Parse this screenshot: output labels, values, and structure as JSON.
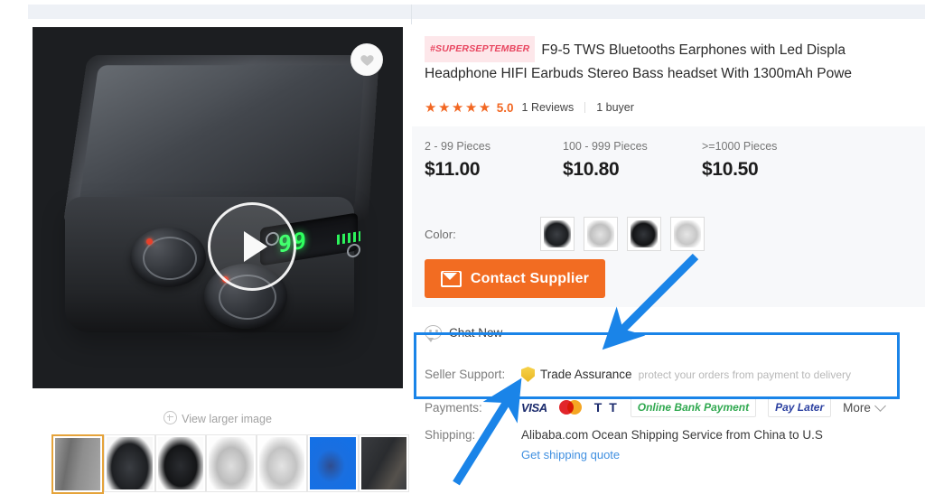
{
  "gallery": {
    "wishlist_icon": "heart-icon",
    "play_icon": "play-button-icon",
    "led_display": "99",
    "view_larger_label": "View larger image",
    "zoom_icon": "magnifier-plus-icon",
    "thumbnails": [
      {
        "name": "thumb-1",
        "selected": true
      },
      {
        "name": "thumb-2",
        "selected": false
      },
      {
        "name": "thumb-3",
        "selected": false
      },
      {
        "name": "thumb-4",
        "selected": false
      },
      {
        "name": "thumb-5",
        "selected": false
      },
      {
        "name": "thumb-6",
        "selected": false
      },
      {
        "name": "thumb-7",
        "selected": false
      }
    ]
  },
  "product": {
    "campaign_tag": "#SUPERSEPTEMBER",
    "title_line1": "F9-5 TWS Bluetooths Earphones with Led Displa",
    "title_line2": "Headphone HIFI Earbuds Stereo Bass headset With 1300mAh Powe",
    "stars": "★★★★★",
    "rating": "5.0",
    "reviews": "1 Reviews",
    "buyers": "1 buyer"
  },
  "pricing": {
    "tiers": [
      {
        "qty": "2 - 99 Pieces",
        "price": "$11.00"
      },
      {
        "qty": "100 - 999 Pieces",
        "price": "$10.80"
      },
      {
        "qty": ">=1000 Pieces",
        "price": "$10.50"
      }
    ]
  },
  "color": {
    "label": "Color:",
    "swatches": [
      "color-swatch-black-open",
      "color-swatch-white-open",
      "color-swatch-black-dark",
      "color-swatch-white-light"
    ]
  },
  "actions": {
    "contact_supplier": "Contact Supplier",
    "contact_icon": "envelope-icon",
    "chat_now": "Chat Now",
    "chat_icon": "chat-bubble-icon"
  },
  "info": {
    "seller_support_label": "Seller Support:",
    "trade_assurance": "Trade Assurance",
    "trade_assurance_icon": "shield-icon",
    "trade_assurance_sub": "protect your orders from payment to delivery",
    "payments_label": "Payments:",
    "payment_methods": [
      "VISA",
      "Mastercard",
      "T T",
      "Online Bank Payment",
      "Pay Later"
    ],
    "payments_more": "More",
    "payments_more_icon": "chevron-down-icon",
    "shipping_label": "Shipping:",
    "shipping_value": "Alibaba.com Ocean Shipping Service from China to U.S",
    "shipping_quote_link": "Get shipping quote"
  },
  "annotations": {
    "highlight_box_color": "#1a84e8",
    "arrow_color": "#1a84e8",
    "arrow_count": 2
  },
  "colors": {
    "accent_orange": "#f26c22",
    "star_orange": "#f26722",
    "link_blue": "#3f8fe0",
    "highlight_blue": "#1a84e8",
    "price_band_bg": "#f7f8fa",
    "campaign_bg": "#fde7ea",
    "campaign_text": "#e8455f"
  }
}
